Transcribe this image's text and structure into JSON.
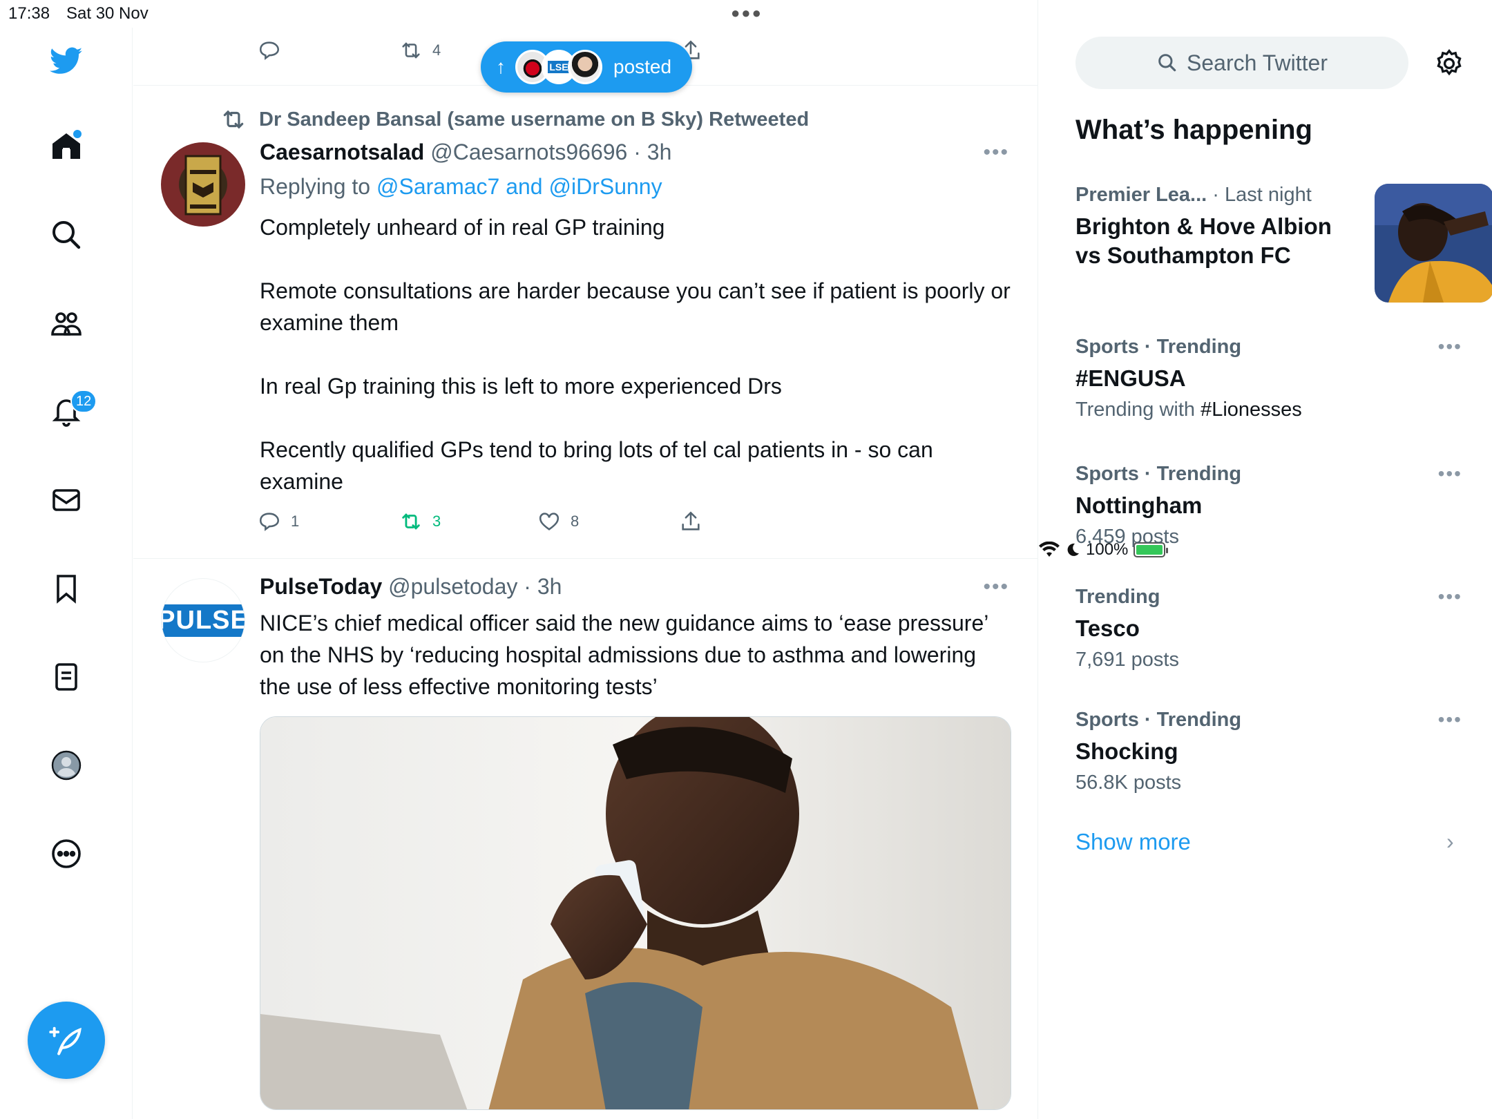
{
  "status_bar": {
    "time": "17:38",
    "date": "Sat 30 Nov",
    "battery": "100%"
  },
  "sidebar": {
    "notifications_badge": "12",
    "items": [
      "twitter-logo",
      "home",
      "explore",
      "communities",
      "notifications",
      "messages",
      "bookmarks",
      "lists",
      "profile",
      "more"
    ]
  },
  "top_tweet_actions": {
    "retweets": "4"
  },
  "posted_pill": {
    "label": "posted"
  },
  "tweet1": {
    "retweeted_by": "Dr Sandeep Bansal (same username on B Sky) Retweeted",
    "name": "Caesarnotsalad",
    "handle": "@Caesarnots96696 · 3h",
    "replying_prefix": "Replying to ",
    "replying_to": "@Saramac7 and @iDrSunny",
    "paragraphs": [
      "Completely unheard of in real GP training",
      "Remote consultations are harder because you can’t see if patient is poorly or examine them",
      "In real Gp training this is left to more experienced Drs",
      "Recently qualified GPs tend to bring lots of tel cal patients in - so can examine"
    ],
    "replies": "1",
    "retweets": "3",
    "likes": "8"
  },
  "tweet2": {
    "name": "PulseToday",
    "handle": "@pulsetoday · 3h",
    "avatar_text": "PULSE",
    "text": "NICE’s chief medical officer said the new guidance aims to ‘ease pressure’ on the NHS by ‘reducing hospital admissions due to asthma and lowering the use of less effective monitoring tests’"
  },
  "right_sidebar": {
    "search_placeholder": "Search Twitter",
    "section_title": "What’s happening",
    "trends": [
      {
        "category": "Premier Lea...",
        "time": "· Last night",
        "title": "Brighton & Hove Albion vs Southampton FC"
      },
      {
        "category": "Sports · Trending",
        "title": "#ENGUSA",
        "sub_prefix": "Trending with ",
        "sub_hl": "#Lionesses"
      },
      {
        "category": "Sports · Trending",
        "title": "Nottingham",
        "sub": "6,459 posts"
      },
      {
        "category": "Trending",
        "title": "Tesco",
        "sub": "7,691 posts"
      },
      {
        "category": "Sports · Trending",
        "title": "Shocking",
        "sub": "56.8K posts"
      }
    ],
    "show_more": "Show more"
  },
  "colors": {
    "accent": "#1d9bf0",
    "retweet_green": "#00ba7c",
    "text_secondary": "#536471"
  }
}
